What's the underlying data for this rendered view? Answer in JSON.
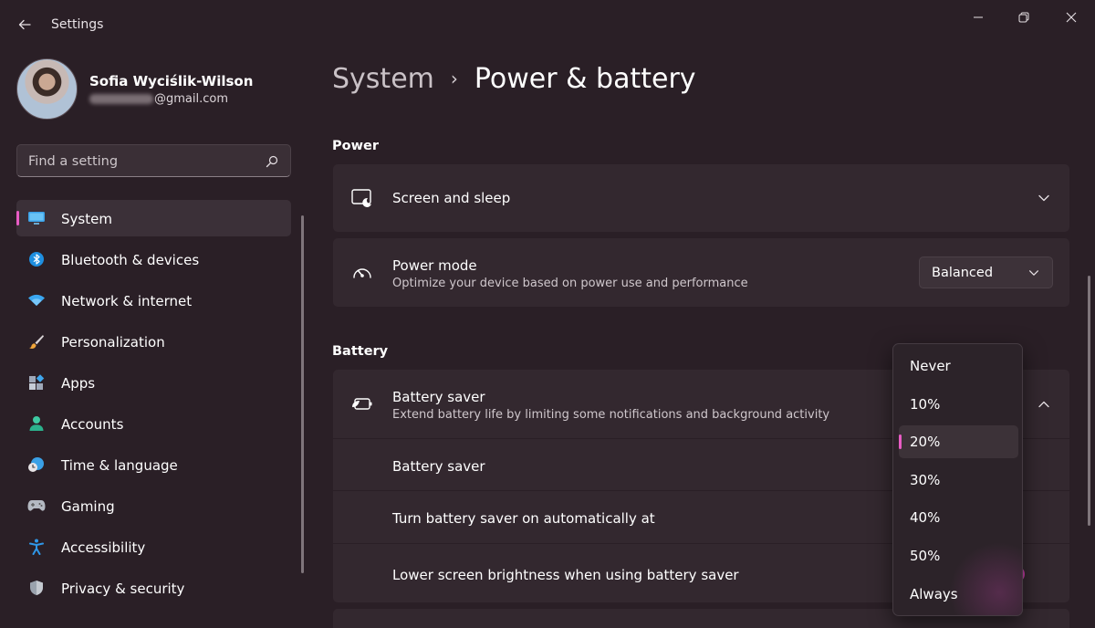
{
  "window": {
    "title": "Settings"
  },
  "profile": {
    "name": "Sofia Wyciślik-Wilson",
    "email_domain": "@gmail.com"
  },
  "search": {
    "placeholder": "Find a setting"
  },
  "sidebar": {
    "items": [
      {
        "label": "System",
        "icon": "monitor-icon",
        "active": true
      },
      {
        "label": "Bluetooth & devices",
        "icon": "bluetooth-icon"
      },
      {
        "label": "Network & internet",
        "icon": "wifi-icon"
      },
      {
        "label": "Personalization",
        "icon": "paintbrush-icon"
      },
      {
        "label": "Apps",
        "icon": "apps-icon"
      },
      {
        "label": "Accounts",
        "icon": "person-icon"
      },
      {
        "label": "Time & language",
        "icon": "clock-globe-icon"
      },
      {
        "label": "Gaming",
        "icon": "gamepad-icon"
      },
      {
        "label": "Accessibility",
        "icon": "accessibility-icon"
      },
      {
        "label": "Privacy & security",
        "icon": "shield-icon"
      }
    ]
  },
  "breadcrumb": {
    "parent": "System",
    "separator": "›",
    "current": "Power & battery"
  },
  "power": {
    "section_title": "Power",
    "screen_sleep": {
      "title": "Screen and sleep"
    },
    "power_mode": {
      "title": "Power mode",
      "description": "Optimize your device based on power use and performance",
      "value": "Balanced"
    }
  },
  "battery": {
    "section_title": "Battery",
    "battery_saver": {
      "title": "Battery saver",
      "description": "Extend battery life by limiting some notifications and background activity"
    },
    "rows": [
      {
        "label": "Battery saver"
      },
      {
        "label": "Turn battery saver on automatically at"
      },
      {
        "label": "Lower screen brightness when using battery saver"
      }
    ]
  },
  "flyout": {
    "options": [
      "Never",
      "10%",
      "20%",
      "30%",
      "40%",
      "50%",
      "Always"
    ],
    "selected": "20%"
  },
  "colors": {
    "accent": "#e85cc4",
    "background": "#2a1f26",
    "card": "#33282f"
  }
}
